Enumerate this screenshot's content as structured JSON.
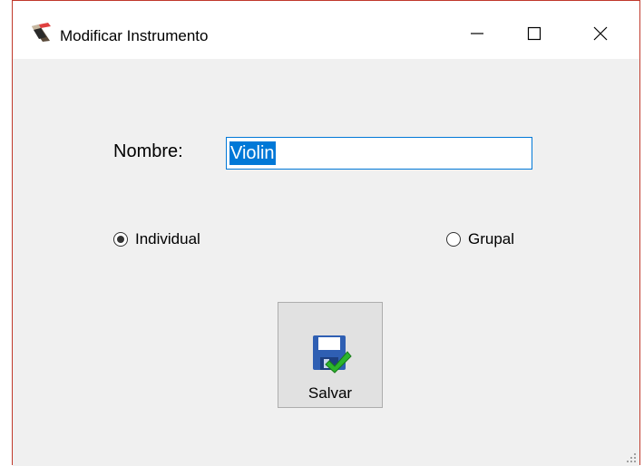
{
  "window": {
    "title": "Modificar Instrumento",
    "app_icon": "instrument-app-icon",
    "controls": {
      "minimize_icon": "minimize-icon",
      "maximize_icon": "maximize-icon",
      "close_icon": "close-icon"
    },
    "border_color": "#c0392b"
  },
  "form": {
    "nombre_label": "Nombre:",
    "nombre_value": "Violin",
    "tipo": {
      "options": [
        {
          "label": "Individual",
          "selected": true
        },
        {
          "label": "Grupal",
          "selected": false
        }
      ]
    },
    "save_button": {
      "label": "Salvar",
      "icon": "save-check-icon"
    }
  },
  "colors": {
    "selection": "#0078d7",
    "client_bg": "#f0f0f0"
  }
}
